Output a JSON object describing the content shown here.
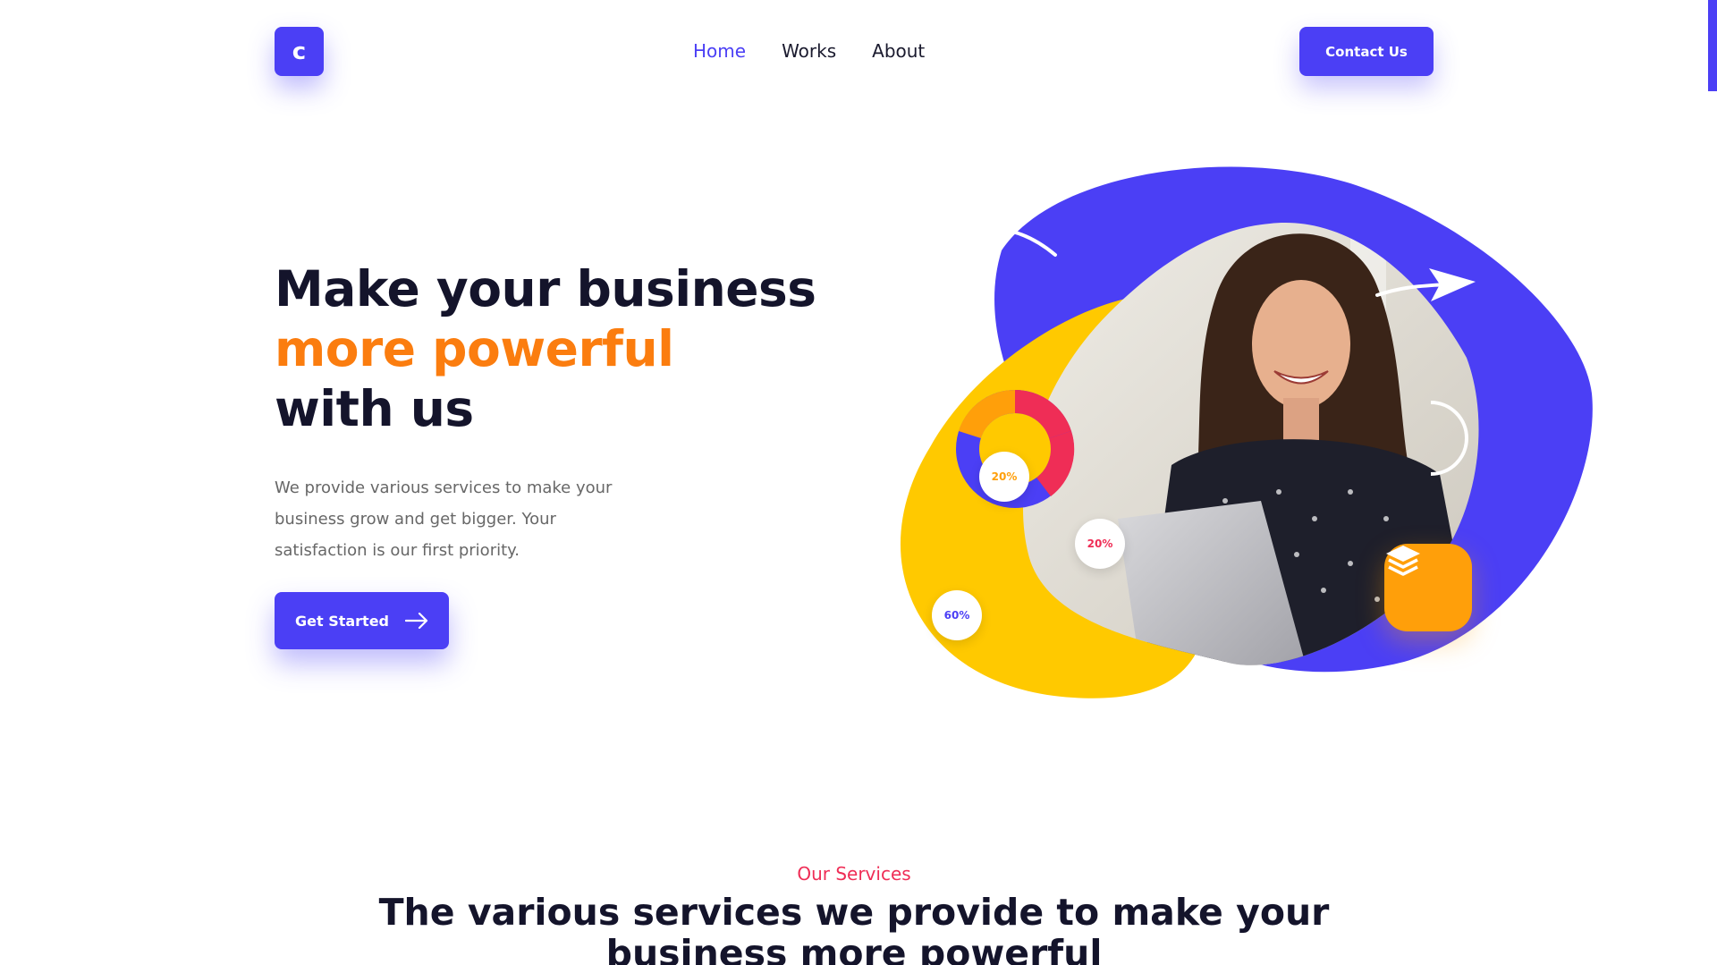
{
  "brand": {
    "logo_letter": "c",
    "accent": "#4b3ff5"
  },
  "nav": {
    "items": [
      {
        "label": "Home",
        "active": true
      },
      {
        "label": "Works",
        "active": false
      },
      {
        "label": "About",
        "active": false
      }
    ],
    "contact_label": "Contact Us"
  },
  "hero": {
    "title_line1": "Make your business",
    "title_accent": "more powerful",
    "title_line3": "with us",
    "description": "We provide various services to make your business grow and get bigger. Your satisfaction is our first priority.",
    "cta_label": "Get Started",
    "cta_icon": "arrow-right-icon"
  },
  "illustration": {
    "donut_badges": [
      {
        "label": "20%",
        "color": "#ff9f0a"
      },
      {
        "label": "20%",
        "color": "#ef2d56"
      },
      {
        "label": "60%",
        "color": "#4b3ff5"
      }
    ],
    "tile_icon": "layers-icon",
    "colors": {
      "blob_blue": "#4b3ff5",
      "blob_yellow": "#ffc900",
      "orange": "#ff9f0a",
      "pink": "#ef2d56"
    }
  },
  "services": {
    "kicker": "Our Services",
    "title": "The various services we provide to make your business more powerful"
  }
}
